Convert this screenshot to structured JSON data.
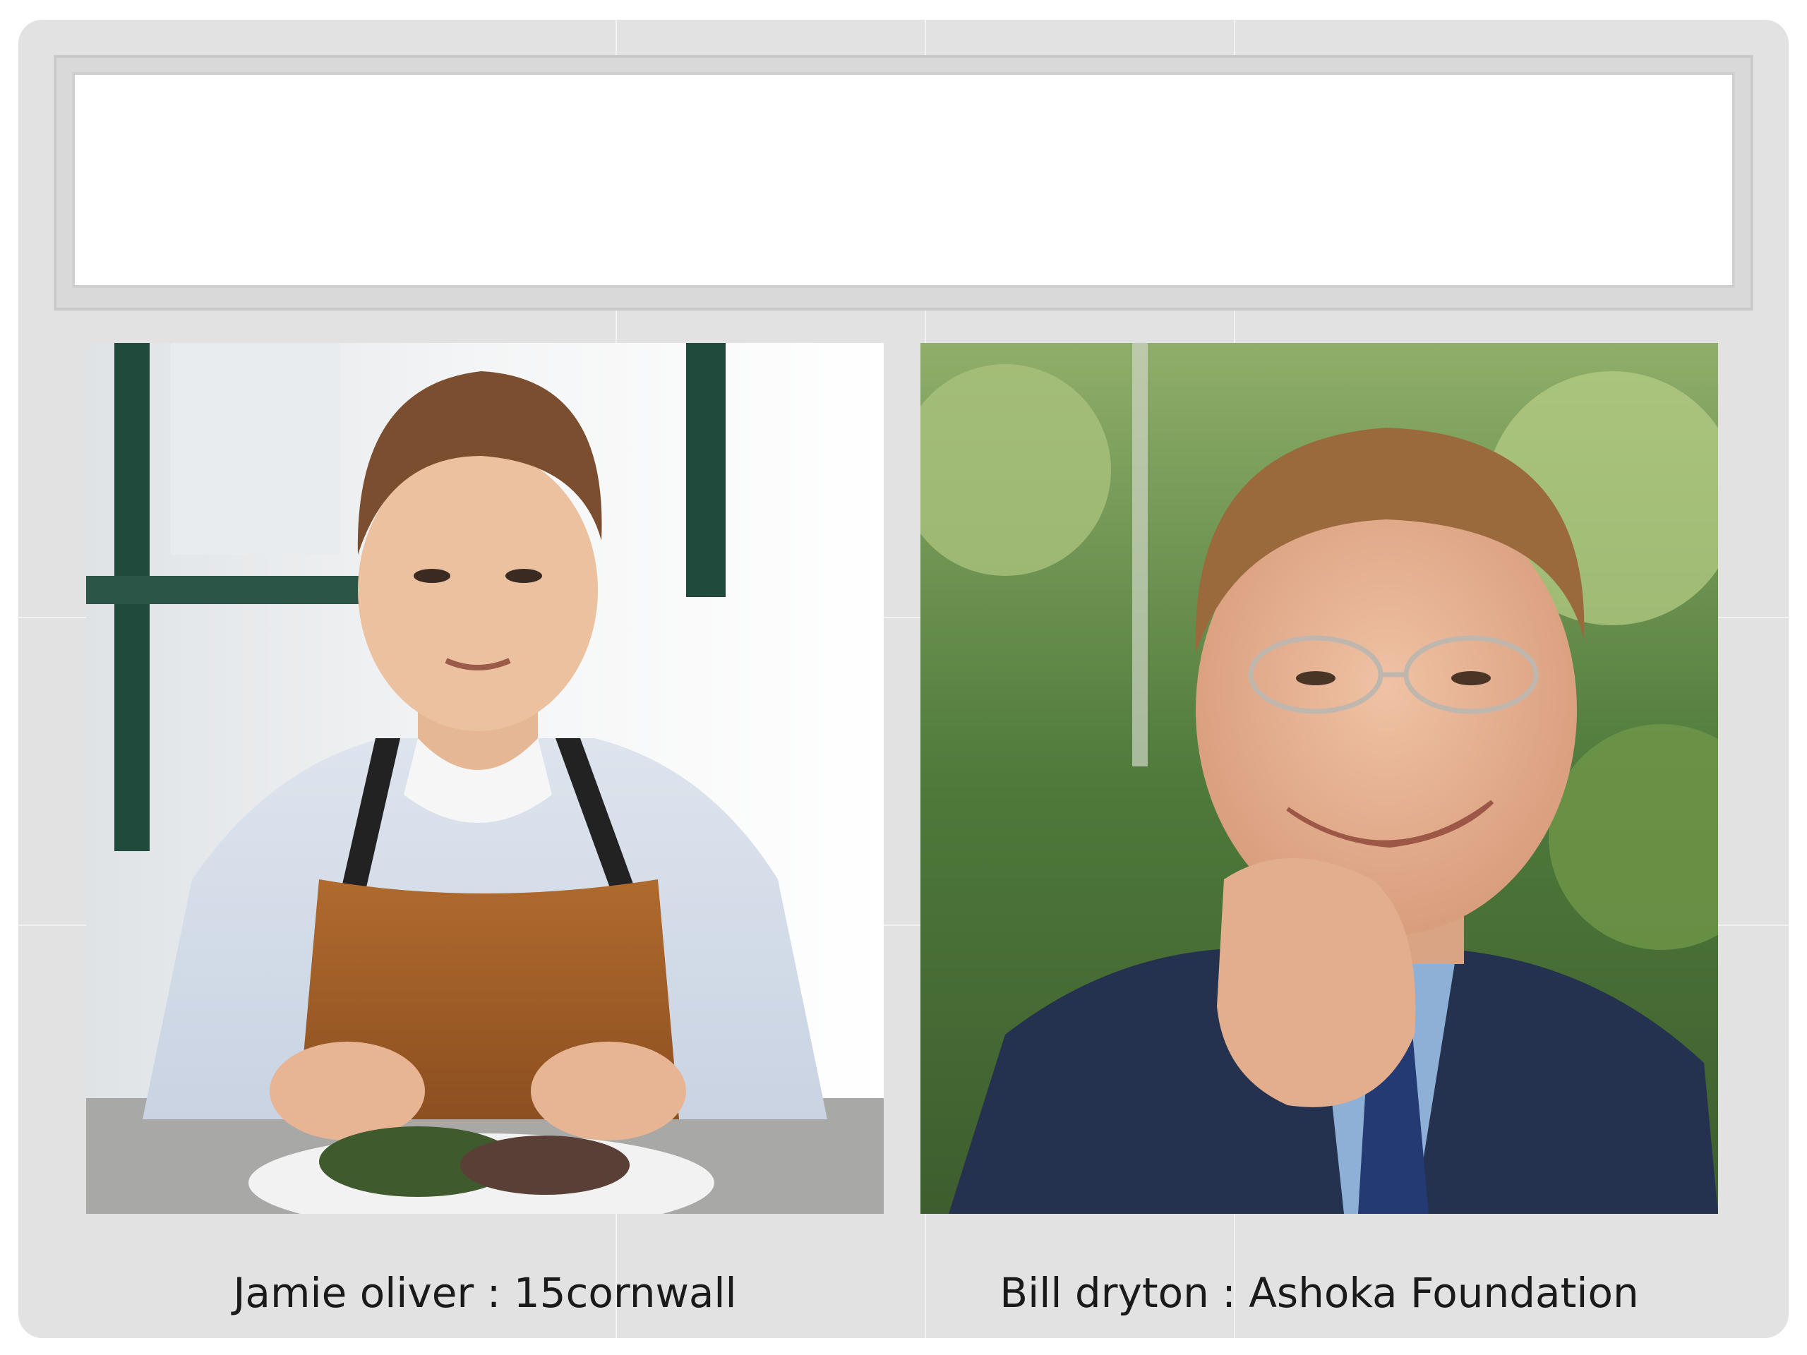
{
  "slide": {
    "title": "",
    "left_panel": {
      "caption": "Jamie oliver : 15cornwall",
      "photo_icon": "portrait-chef-photo"
    },
    "right_panel": {
      "caption": "Bill dryton : Ashoka Foundation",
      "photo_icon": "portrait-man-photo"
    }
  },
  "colors": {
    "slide_bg": "#e2e2e2",
    "title_box": "#ffffff",
    "text": "#1a1a1a"
  }
}
